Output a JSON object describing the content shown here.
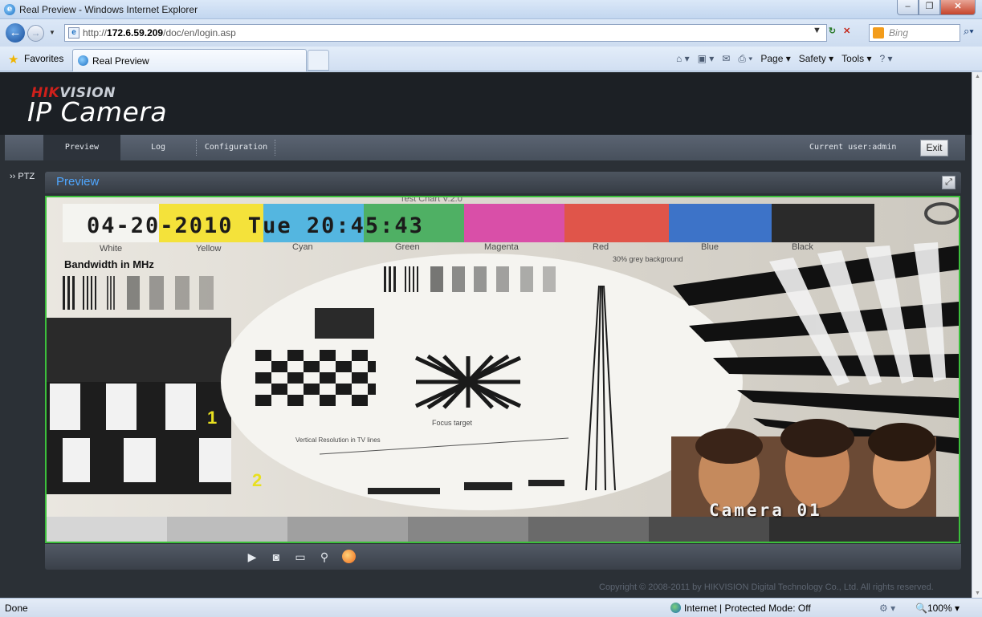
{
  "browser": {
    "window_title": "Real Preview - Windows Internet Explorer",
    "url_prefix": "http://",
    "url_host": "172.6.59.209",
    "url_path": "/doc/en/login.asp",
    "search_placeholder": "Bing",
    "favorites_label": "Favorites",
    "tab_label": "Real Preview",
    "command_bar": [
      "Page ▾",
      "Safety ▾",
      "Tools ▾"
    ],
    "status_text": "Done",
    "zone_text": "Internet | Protected Mode: Off",
    "zoom_text": "100%"
  },
  "app": {
    "brand_red": "HIK",
    "brand_gray": "VISION",
    "product_name": "IP Camera",
    "menu": {
      "preview": "Preview",
      "log": "Log",
      "configuration": "Configuration"
    },
    "current_user": "Current user:admin",
    "exit_label": "Exit",
    "ptz_label": "›› PTZ",
    "panel_title": "Preview",
    "video_osd": {
      "date_time": "04-20-2010 Tue 20:45:43",
      "camera_name": "Camera 01"
    },
    "test_chart": {
      "title": "Test Chart V.2.0",
      "color_labels": [
        "White",
        "Yellow",
        "Cyan",
        "Green",
        "Magenta",
        "Red",
        "Blue",
        "Black"
      ],
      "bandwidth_label": "Bandwidth in MHz",
      "background_note": "30% grey background",
      "focus_label": "Focus target",
      "tv_lines_label": "Vertical Resolution in TV lines"
    },
    "copyright": "Copyright © 2008-2011 by HIKVISION Digital Technology Co., Ltd. All rights reserved.",
    "colors": {
      "accent_blue": "#4ea6ff",
      "video_border": "#3cbf3c",
      "brand_red": "#d0201b"
    }
  }
}
